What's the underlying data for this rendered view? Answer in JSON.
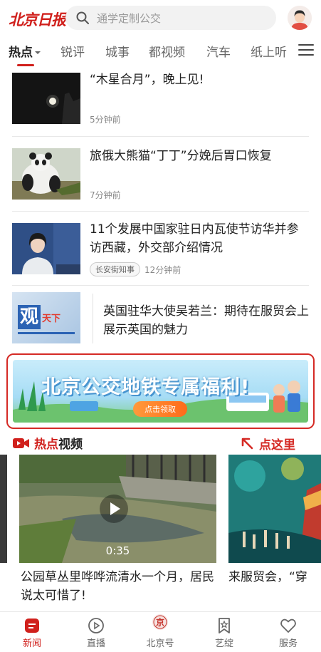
{
  "app": {
    "logo_text": "北京日报",
    "accent": "#d0201c"
  },
  "search": {
    "placeholder": "通学定制公交",
    "icon": "search-icon"
  },
  "tabs": [
    {
      "label": "热点",
      "active": true
    },
    {
      "label": "锐评"
    },
    {
      "label": "城事"
    },
    {
      "label": "都视频"
    },
    {
      "label": "汽车"
    },
    {
      "label": "纸上听"
    }
  ],
  "news": [
    {
      "title": "“木星合月”，晚上见!",
      "time": "5分钟前"
    },
    {
      "title": "旅俄大熊猫“丁丁”分娩后胃口恢复",
      "time": "7分钟前"
    },
    {
      "title": "11个发展中国家驻日内瓦使节访华并参访西藏，外交部介绍情况",
      "tag": "长安街知事",
      "time": "12分钟前"
    },
    {
      "title": "英国驻华大使吴若兰：期待在服贸会上展示英国的魅力",
      "thumb_text_1": "观",
      "thumb_text_2": "天下"
    }
  ],
  "banner": {
    "title": "北京公交地铁专属福利!",
    "button": "点击领取"
  },
  "annotation": {
    "label": "点这里",
    "color": "#d52a25"
  },
  "hot_video": {
    "header_red": "热点",
    "header_black": "视频",
    "videos": [
      {
        "duration": "0:35",
        "title": "公园草丛里哗哗流清水一个月，居民说太可惜了!"
      },
      {
        "title": "来服贸会，“穿"
      }
    ]
  },
  "bottom_nav": [
    {
      "label": "新闻",
      "icon": "news-icon",
      "active": true
    },
    {
      "label": "直播",
      "icon": "live-play-icon"
    },
    {
      "label": "北京号",
      "icon": "beijing-seal-icon",
      "icon_text": "京"
    },
    {
      "label": "艺绽",
      "icon": "bookmark-star-icon"
    },
    {
      "label": "服务",
      "icon": "heart-icon"
    }
  ]
}
